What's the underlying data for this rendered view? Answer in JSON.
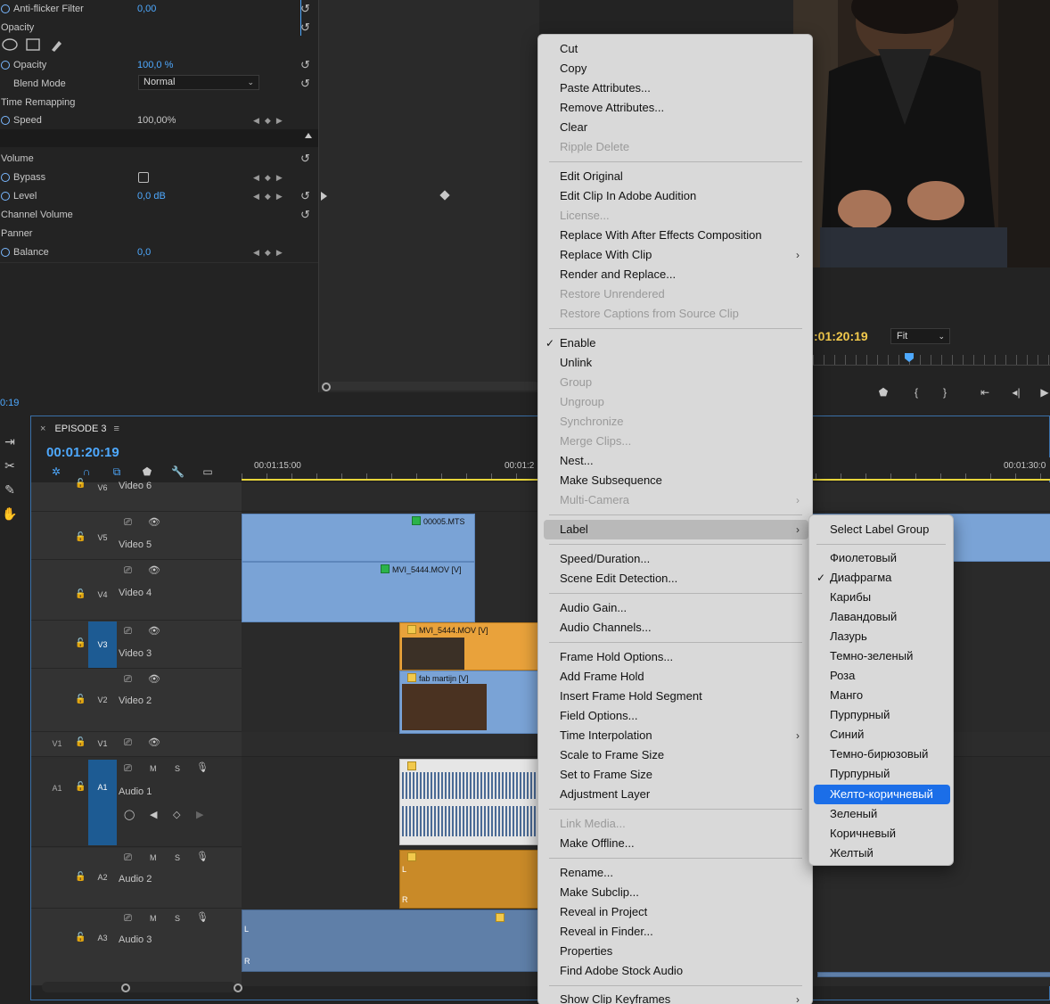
{
  "effect_controls": {
    "anti_flicker": {
      "label": "Anti-flicker Filter",
      "value": "0,00"
    },
    "opacity_section": "Opacity",
    "opacity": {
      "label": "Opacity",
      "value": "100,0 %"
    },
    "blend_mode": {
      "label": "Blend Mode",
      "value": "Normal"
    },
    "time_remapping": "Time Remapping",
    "speed": {
      "label": "Speed",
      "value": "100,00%"
    },
    "volume_section": "Volume",
    "bypass": {
      "label": "Bypass"
    },
    "level": {
      "label": "Level",
      "value": "0,0 dB"
    },
    "channel_volume": "Channel Volume",
    "panner": "Panner",
    "balance": {
      "label": "Balance",
      "value": "0,0"
    },
    "timecode": "0:19"
  },
  "program_monitor": {
    "timecode": ":01:20:19",
    "fit": "Fit"
  },
  "timeline": {
    "sequence_name": "EPISODE 3",
    "timecode": "00:01:20:19",
    "ruler": [
      "00:01:15:00",
      "00:01:2",
      "00:01:30:0"
    ],
    "tracks": {
      "v6": {
        "id": "V6",
        "name": "Video 6"
      },
      "v5": {
        "id": "V5",
        "name": "Video 5"
      },
      "v4": {
        "id": "V4",
        "name": "Video 4"
      },
      "v3": {
        "id": "V3",
        "name": "Video 3"
      },
      "v2": {
        "id": "V2",
        "name": "Video 2"
      },
      "v1": {
        "id": "V1",
        "source": "V1"
      },
      "a1": {
        "id": "A1",
        "source": "A1",
        "name": "Audio 1"
      },
      "a2": {
        "id": "A2",
        "name": "Audio 2"
      },
      "a3": {
        "id": "A3",
        "name": "Audio 3"
      }
    },
    "m_label": "M",
    "s_label": "S",
    "channel_l": "L",
    "channel_r": "R",
    "clips": {
      "c1": "00005.MTS",
      "c2": "MVI_5444.MOV [V]",
      "c3": "MVI_5444.MOV [V]",
      "c4": "fab martijn [V]"
    }
  },
  "context_menu": {
    "items": [
      "Cut",
      "Copy",
      "Paste Attributes...",
      "Remove Attributes...",
      "Clear",
      "Ripple Delete",
      "Edit Original",
      "Edit Clip In Adobe Audition",
      "License...",
      "Replace With After Effects Composition",
      "Replace With Clip",
      "Render and Replace...",
      "Restore Unrendered",
      "Restore Captions from Source Clip",
      "Enable",
      "Unlink",
      "Group",
      "Ungroup",
      "Synchronize",
      "Merge Clips...",
      "Nest...",
      "Make Subsequence",
      "Multi-Camera",
      "Label",
      "Speed/Duration...",
      "Scene Edit Detection...",
      "Audio Gain...",
      "Audio Channels...",
      "Frame Hold Options...",
      "Add Frame Hold",
      "Insert Frame Hold Segment",
      "Field Options...",
      "Time Interpolation",
      "Scale to Frame Size",
      "Set to Frame Size",
      "Adjustment Layer",
      "Link Media...",
      "Make Offline...",
      "Rename...",
      "Make Subclip...",
      "Reveal in Project",
      "Reveal in Finder...",
      "Properties",
      "Find Adobe Stock Audio",
      "Show Clip Keyframes"
    ]
  },
  "label_submenu": {
    "header": "Select Label Group",
    "items": [
      "Фиолетовый",
      "Диафрагма",
      "Карибы",
      "Лавандовый",
      "Лазурь",
      "Темно-зеленый",
      "Роза",
      "Манго",
      "Пурпурный",
      "Синий",
      "Темно-бирюзовый",
      "Пурпурный",
      "Желто-коричневый",
      "Зеленый",
      "Коричневый",
      "Желтый"
    ],
    "checked": "Диафрагма",
    "selected": "Желто-коричневый"
  },
  "colors": {
    "accent": "#4ea9ff",
    "timecode_yellow": "#f2c94c",
    "menu_selected": "#1b6ee8",
    "clip_blue": "#7aa3d6",
    "clip_orange": "#e9a23b"
  }
}
